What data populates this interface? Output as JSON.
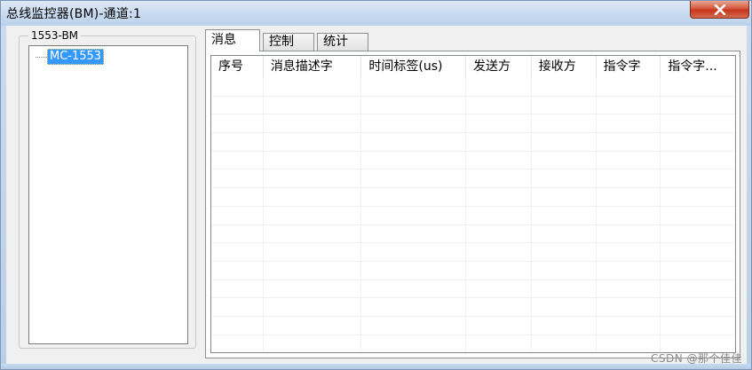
{
  "window": {
    "title": "总线监控器(BM)-通道:1"
  },
  "icons": {
    "close": "close-icon"
  },
  "group": {
    "title": "1553-BM",
    "tree_node": "MC-1553"
  },
  "tabs": [
    {
      "label": "消息",
      "active": true
    },
    {
      "label": "控制",
      "active": false
    },
    {
      "label": "统计",
      "active": false
    }
  ],
  "table": {
    "columns": [
      "序号",
      "消息描述字",
      "时间标签(us)",
      "发送方",
      "接收方",
      "指令字",
      "指令字..."
    ]
  },
  "watermark": "CSDN @那个佳佳",
  "colors": {
    "selection": "#3399ff",
    "close_button": "#c7361c"
  }
}
